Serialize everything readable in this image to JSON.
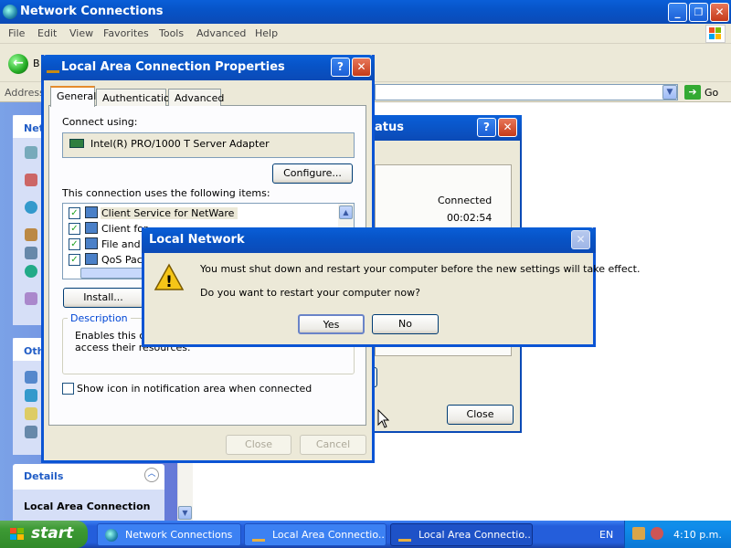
{
  "main_window": {
    "title": "Network Connections",
    "menu": [
      "File",
      "Edit",
      "View",
      "Favorites",
      "Tools",
      "Advanced",
      "Help"
    ],
    "back_label": "B",
    "address_label": "Address",
    "go_label": "Go",
    "left_pane": {
      "network_tasks_title": "Netw",
      "other_places_title": "Oth",
      "details_title": "Details",
      "details_name": "Local Area Connection"
    }
  },
  "status_window": {
    "title_fragment": "atus",
    "state": "Connected",
    "duration": "00:02:54",
    "close_label": "Close"
  },
  "properties_window": {
    "title": "Local Area Connection Properties",
    "tabs": [
      "General",
      "Authentication",
      "Advanced"
    ],
    "active_tab": "General",
    "connect_using_label": "Connect using:",
    "adapter": "Intel(R) PRO/1000 T Server Adapter",
    "configure_label": "Configure...",
    "items_label": "This connection uses the following items:",
    "items": [
      {
        "label": "Client Service for NetWare",
        "checked": true
      },
      {
        "label": "Client for",
        "checked": true
      },
      {
        "label": "File and P",
        "checked": true
      },
      {
        "label": "QoS Pac",
        "checked": true
      }
    ],
    "install_label": "Install...",
    "description_legend": "Description",
    "description_line1": "Enables this co",
    "description_line2": "access their resources.",
    "show_icon_label": "Show icon in notification area when connected",
    "show_icon_checked": false,
    "close_label": "Close",
    "cancel_label": "Cancel"
  },
  "dialog": {
    "title": "Local Network",
    "message_line1": "You must shut down and restart your computer before the new settings will take effect.",
    "message_line2": "Do you want to restart your computer now?",
    "yes_label": "Yes",
    "no_label": "No",
    "warning_symbol": "!"
  },
  "titlebar_buttons": {
    "minimize": "_",
    "restore": "❐",
    "close": "✕",
    "help": "?"
  },
  "taskbar": {
    "start_label": "start",
    "tasks": [
      {
        "label": "Network Connections",
        "active": false
      },
      {
        "label": "Local Area Connectio...",
        "active": false
      },
      {
        "label": "Local Area Connectio...",
        "active": true
      }
    ],
    "language": "EN",
    "clock": "4:10 p.m."
  },
  "colors": {
    "titlebar_blue": "#0b54d4",
    "taskbar_blue": "#245edb",
    "start_green": "#3d9a34",
    "window_face": "#ece9d8",
    "link_blue": "#215dc6"
  }
}
